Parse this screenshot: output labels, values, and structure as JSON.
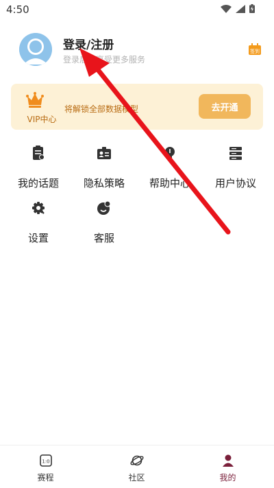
{
  "status_bar": {
    "time": "4:50",
    "icons": [
      "wifi-icon",
      "signal-icon",
      "battery-icon"
    ]
  },
  "profile": {
    "title": "登录/注册",
    "subtitle": "登录后可享受更多服务",
    "avatar_icon": "user-avatar-icon",
    "checkin_icon": "calendar-checkin-icon",
    "checkin_label": "签到"
  },
  "vip_card": {
    "label": "VIP中心",
    "description": "将解锁全部数据模型",
    "button_label": "去开通",
    "icon": "crown-icon"
  },
  "menu": {
    "items": [
      {
        "label": "我的话题",
        "icon": "clipboard-icon"
      },
      {
        "label": "隐私策略",
        "icon": "id-card-icon"
      },
      {
        "label": "帮助中心",
        "icon": "lightbulb-icon"
      },
      {
        "label": "用户协议",
        "icon": "server-list-icon"
      },
      {
        "label": "设置",
        "icon": "gear-icon"
      },
      {
        "label": "客服",
        "icon": "customer-service-icon"
      }
    ]
  },
  "tab_bar": {
    "tabs": [
      {
        "label": "赛程",
        "icon": "scoreboard-icon",
        "active": false
      },
      {
        "label": "社区",
        "icon": "planet-icon",
        "active": false
      },
      {
        "label": "我的",
        "icon": "person-icon",
        "active": true
      }
    ]
  },
  "colors": {
    "accent_active": "#7a1f3a",
    "vip_bg": "#fdf1d6",
    "vip_text": "#b86b12",
    "vip_button": "#f1b75c",
    "annotation_arrow": "#e8141b"
  }
}
